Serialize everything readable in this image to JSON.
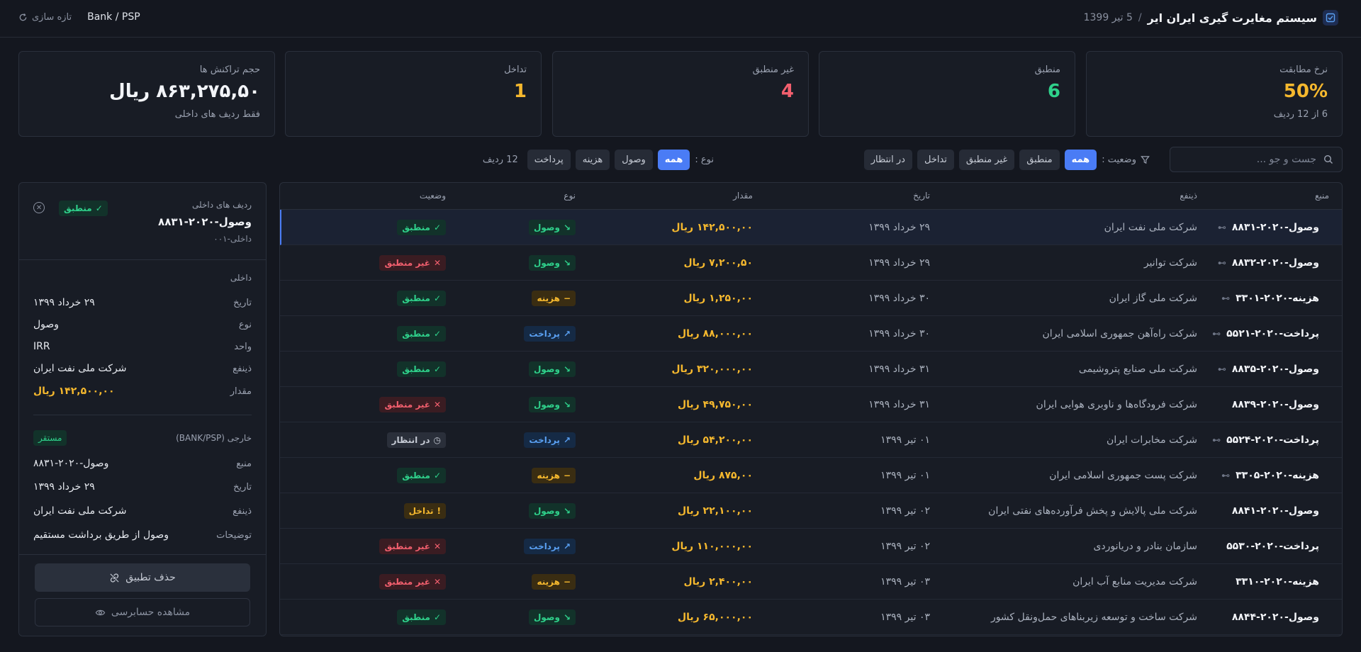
{
  "header": {
    "title": "سیستم مغایرت گیری ایران ایر",
    "separator": "/",
    "date": "5 تیر 1399",
    "bank_psp": "Bank / PSP",
    "refresh_label": "تازه سازی"
  },
  "stats": [
    {
      "label": "نرخ مطابقت",
      "value": "50%",
      "sub": "6 از 12 ردیف",
      "color": "#f5b82e"
    },
    {
      "label": "منطبق",
      "value": "6",
      "sub": "",
      "color": "#2fd18b"
    },
    {
      "label": "غیر منطبق",
      "value": "4",
      "sub": "",
      "color": "#f25f6e"
    },
    {
      "label": "تداخل",
      "value": "1",
      "sub": "",
      "color": "#f5b82e"
    },
    {
      "label": "حجم تراکنش ها",
      "value": "۸۶۳,۲۷۵,۵۰ ریال",
      "sub": "فقط ردیف های داخلی",
      "color": "#f2f4f8"
    }
  ],
  "filters": {
    "search_placeholder": "جست و جو ...",
    "status_label": "وضعیت :",
    "status_chips": [
      "همه",
      "منطبق",
      "غیر منطبق",
      "تداخل",
      "در انتظار"
    ],
    "type_label": "نوع :",
    "type_chips": [
      "همه",
      "وصول",
      "هزینه",
      "پرداخت"
    ],
    "row_count": "12 ردیف"
  },
  "table": {
    "headers": {
      "source": "منبع",
      "payee": "ذینفع",
      "date": "تاریخ",
      "amount": "مقدار",
      "type": "نوع",
      "status": "وضعیت"
    },
    "rows": [
      {
        "source": "وصول-۲۰۲۰-۸۸۳۱",
        "linked": true,
        "payee": "شرکت ملی نفت ایران",
        "date": "۲۹ خرداد ۱۳۹۹",
        "amount": "۱۴۲,۵۰۰,۰۰ ریال",
        "type": "وصول",
        "type_kind": "in",
        "status": "منطبق",
        "status_kind": "ok"
      },
      {
        "source": "وصول-۲۰۲۰-۸۸۳۲",
        "linked": true,
        "payee": "شرکت توانیر",
        "date": "۲۹ خرداد ۱۳۹۹",
        "amount": "۷,۲۰۰,۵۰ ریال",
        "type": "وصول",
        "type_kind": "in",
        "status": "غیر منطبق",
        "status_kind": "bad"
      },
      {
        "source": "هزینه-۲۰۲۰-۳۳۰۱",
        "linked": true,
        "payee": "شرکت ملی گاز ایران",
        "date": "۳۰ خرداد ۱۳۹۹",
        "amount": "۱,۲۵۰,۰۰ ریال",
        "type": "هزینه",
        "type_kind": "exp",
        "status": "منطبق",
        "status_kind": "ok"
      },
      {
        "source": "پرداخت-۲۰۲۰-۵۵۲۱",
        "linked": true,
        "payee": "شرکت راه‌آهن جمهوری اسلامی ایران",
        "date": "۳۰ خرداد ۱۳۹۹",
        "amount": "۸۸,۰۰۰,۰۰ ریال",
        "type": "پرداخت",
        "type_kind": "pay",
        "status": "منطبق",
        "status_kind": "ok"
      },
      {
        "source": "وصول-۲۰۲۰-۸۸۳۵",
        "linked": true,
        "payee": "شرکت ملی صنایع پتروشیمی",
        "date": "۳۱ خرداد ۱۳۹۹",
        "amount": "۳۲۰,۰۰۰,۰۰ ریال",
        "type": "وصول",
        "type_kind": "in",
        "status": "منطبق",
        "status_kind": "ok"
      },
      {
        "source": "وصول-۲۰۲۰-۸۸۳۹",
        "linked": false,
        "payee": "شرکت فرودگاه‌ها و ناوبری هوایی ایران",
        "date": "۳۱ خرداد ۱۳۹۹",
        "amount": "۴۹,۷۵۰,۰۰ ریال",
        "type": "وصول",
        "type_kind": "in",
        "status": "غیر منطبق",
        "status_kind": "bad"
      },
      {
        "source": "پرداخت-۲۰۲۰-۵۵۲۴",
        "linked": true,
        "payee": "شرکت مخابرات ایران",
        "date": "۰۱ تیر ۱۳۹۹",
        "amount": "۵۴,۲۰۰,۰۰ ریال",
        "type": "پرداخت",
        "type_kind": "pay",
        "status": "در انتظار",
        "status_kind": "pend"
      },
      {
        "source": "هزینه-۲۰۲۰-۳۳۰۵",
        "linked": true,
        "payee": "شرکت پست جمهوری اسلامی ایران",
        "date": "۰۱ تیر ۱۳۹۹",
        "amount": "۸۷۵,۰۰ ریال",
        "type": "هزینه",
        "type_kind": "exp",
        "status": "منطبق",
        "status_kind": "ok"
      },
      {
        "source": "وصول-۲۰۲۰-۸۸۴۱",
        "linked": false,
        "payee": "شرکت ملی پالایش و پخش فرآورده‌های نفتی ایران",
        "date": "۰۲ تیر ۱۳۹۹",
        "amount": "۲۲,۱۰۰,۰۰ ریال",
        "type": "وصول",
        "type_kind": "in",
        "status": "تداخل",
        "status_kind": "conf"
      },
      {
        "source": "پرداخت-۲۰۲۰-۵۵۳۰",
        "linked": false,
        "payee": "سازمان بنادر و دریانوردی",
        "date": "۰۲ تیر ۱۳۹۹",
        "amount": "۱۱۰,۰۰۰,۰۰ ریال",
        "type": "پرداخت",
        "type_kind": "pay",
        "status": "غیر منطبق",
        "status_kind": "bad"
      },
      {
        "source": "هزینه-۲۰۲۰-۳۳۱۰",
        "linked": false,
        "payee": "شرکت مدیریت منابع آب ایران",
        "date": "۰۳ تیر ۱۳۹۹",
        "amount": "۲,۴۰۰,۰۰ ریال",
        "type": "هزینه",
        "type_kind": "exp",
        "status": "غیر منطبق",
        "status_kind": "bad"
      },
      {
        "source": "وصول-۲۰۲۰-۸۸۴۴",
        "linked": false,
        "payee": "شرکت ساخت و توسعه زیربناهای حمل‌ونقل کشور",
        "date": "۰۳ تیر ۱۳۹۹",
        "amount": "۶۵,۰۰۰,۰۰ ریال",
        "type": "وصول",
        "type_kind": "in",
        "status": "منطبق",
        "status_kind": "ok"
      }
    ]
  },
  "panel": {
    "label": "ردیف های داخلی",
    "title": "وصول-۲۰۲۰-۸۸۳۱",
    "sub": "داخلی-۰۰۱",
    "status": "منطبق",
    "internal_label": "داخلی",
    "internal": [
      {
        "k": "تاریخ",
        "v": "۲۹ خرداد ۱۳۹۹"
      },
      {
        "k": "نوع",
        "v": "وصول"
      },
      {
        "k": "واحد",
        "v": "IRR"
      },
      {
        "k": "ذینفع",
        "v": "شرکت ملی نفت ایران"
      },
      {
        "k": "مقدار",
        "v": "۱۴۲,۵۰۰,۰۰ ریال"
      }
    ],
    "external_label": "خارجی (BANK/PSP)",
    "external_badge": "مستقر",
    "external": [
      {
        "k": "منبع",
        "v": "وصول-۲۰۲۰-۸۸۳۱"
      },
      {
        "k": "تاریخ",
        "v": "۲۹ خرداد ۱۳۹۹"
      },
      {
        "k": "ذینفع",
        "v": "شرکت ملی نفت ایران"
      },
      {
        "k": "توضیحات",
        "v": "وصول از طریق برداشت مستقیم"
      }
    ],
    "unmatch_label": "حذف تطبیق",
    "audit_label": "مشاهده حسابرسی"
  }
}
